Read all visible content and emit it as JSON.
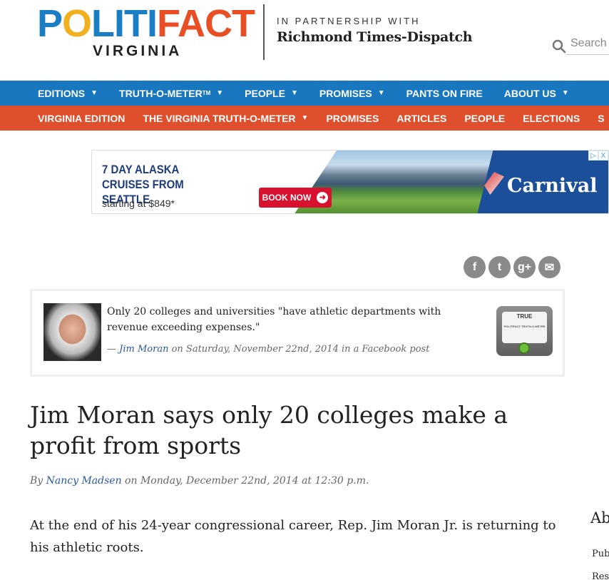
{
  "header": {
    "logo_pol": "P",
    "logo_check": "O",
    "logo_liti": "LITI",
    "logo_fact": "FACT",
    "logo_sub": "VIRGINIA",
    "partner_line1": "IN PARTNERSHIP WITH",
    "partner_line2": "Richmond Times-Dispatch",
    "search_placeholder": "Search"
  },
  "nav_primary": [
    {
      "label": "EDITIONS",
      "has_dropdown": true
    },
    {
      "label": "TRUTH-O-METER",
      "sup": "TM",
      "has_dropdown": true
    },
    {
      "label": "PEOPLE",
      "has_dropdown": true
    },
    {
      "label": "PROMISES",
      "has_dropdown": true
    },
    {
      "label": "PANTS ON FIRE",
      "has_dropdown": false
    },
    {
      "label": "ABOUT US",
      "has_dropdown": true
    }
  ],
  "nav_secondary": [
    {
      "label": "VIRGINIA EDITION"
    },
    {
      "label": "THE VIRGINIA TRUTH-O-METER",
      "has_dropdown": true
    },
    {
      "label": "PROMISES"
    },
    {
      "label": "ARTICLES"
    },
    {
      "label": "PEOPLE"
    },
    {
      "label": "ELECTIONS"
    },
    {
      "label": "S"
    }
  ],
  "ad": {
    "title": "7 DAY ALASKA CRUISES FROM SEATTLE",
    "price": "starting at $849*",
    "cta": "BOOK NOW",
    "brand": "Carnival",
    "adchoices": "▷",
    "close": "X"
  },
  "share": {
    "facebook": "f",
    "twitter": "t",
    "googleplus": "g+",
    "email": "✉"
  },
  "statement": {
    "quote": "Only 20 colleges and universities \"have athletic departments with revenue exceeding expenses.\"",
    "dash": "— ",
    "speaker": "Jim Moran",
    "context": " on Saturday, November 22nd, 2014 in a Facebook post",
    "rating": "TRUE",
    "meter_caption": "POLITIFACT TRUTH-O-METER"
  },
  "article": {
    "headline": "Jim Moran says only 20 colleges make a profit from sports",
    "by": "By ",
    "author": "Nancy Madsen",
    "date": " on Monday, December 22nd, 2014 at 12:30 p.m.",
    "body": "At the end of his 24-year congressional career, Rep. Jim Moran Jr. is returning to his athletic roots."
  },
  "aside": {
    "title": "Ab",
    "line1": "Pub",
    "line2": "Res"
  },
  "colors": {
    "nav_primary_bg": "#1877be",
    "nav_secondary_bg": "#e04f2b",
    "logo_blue": "#1a7ec4",
    "logo_orange": "#e94e24",
    "link": "#2a5aa0"
  }
}
